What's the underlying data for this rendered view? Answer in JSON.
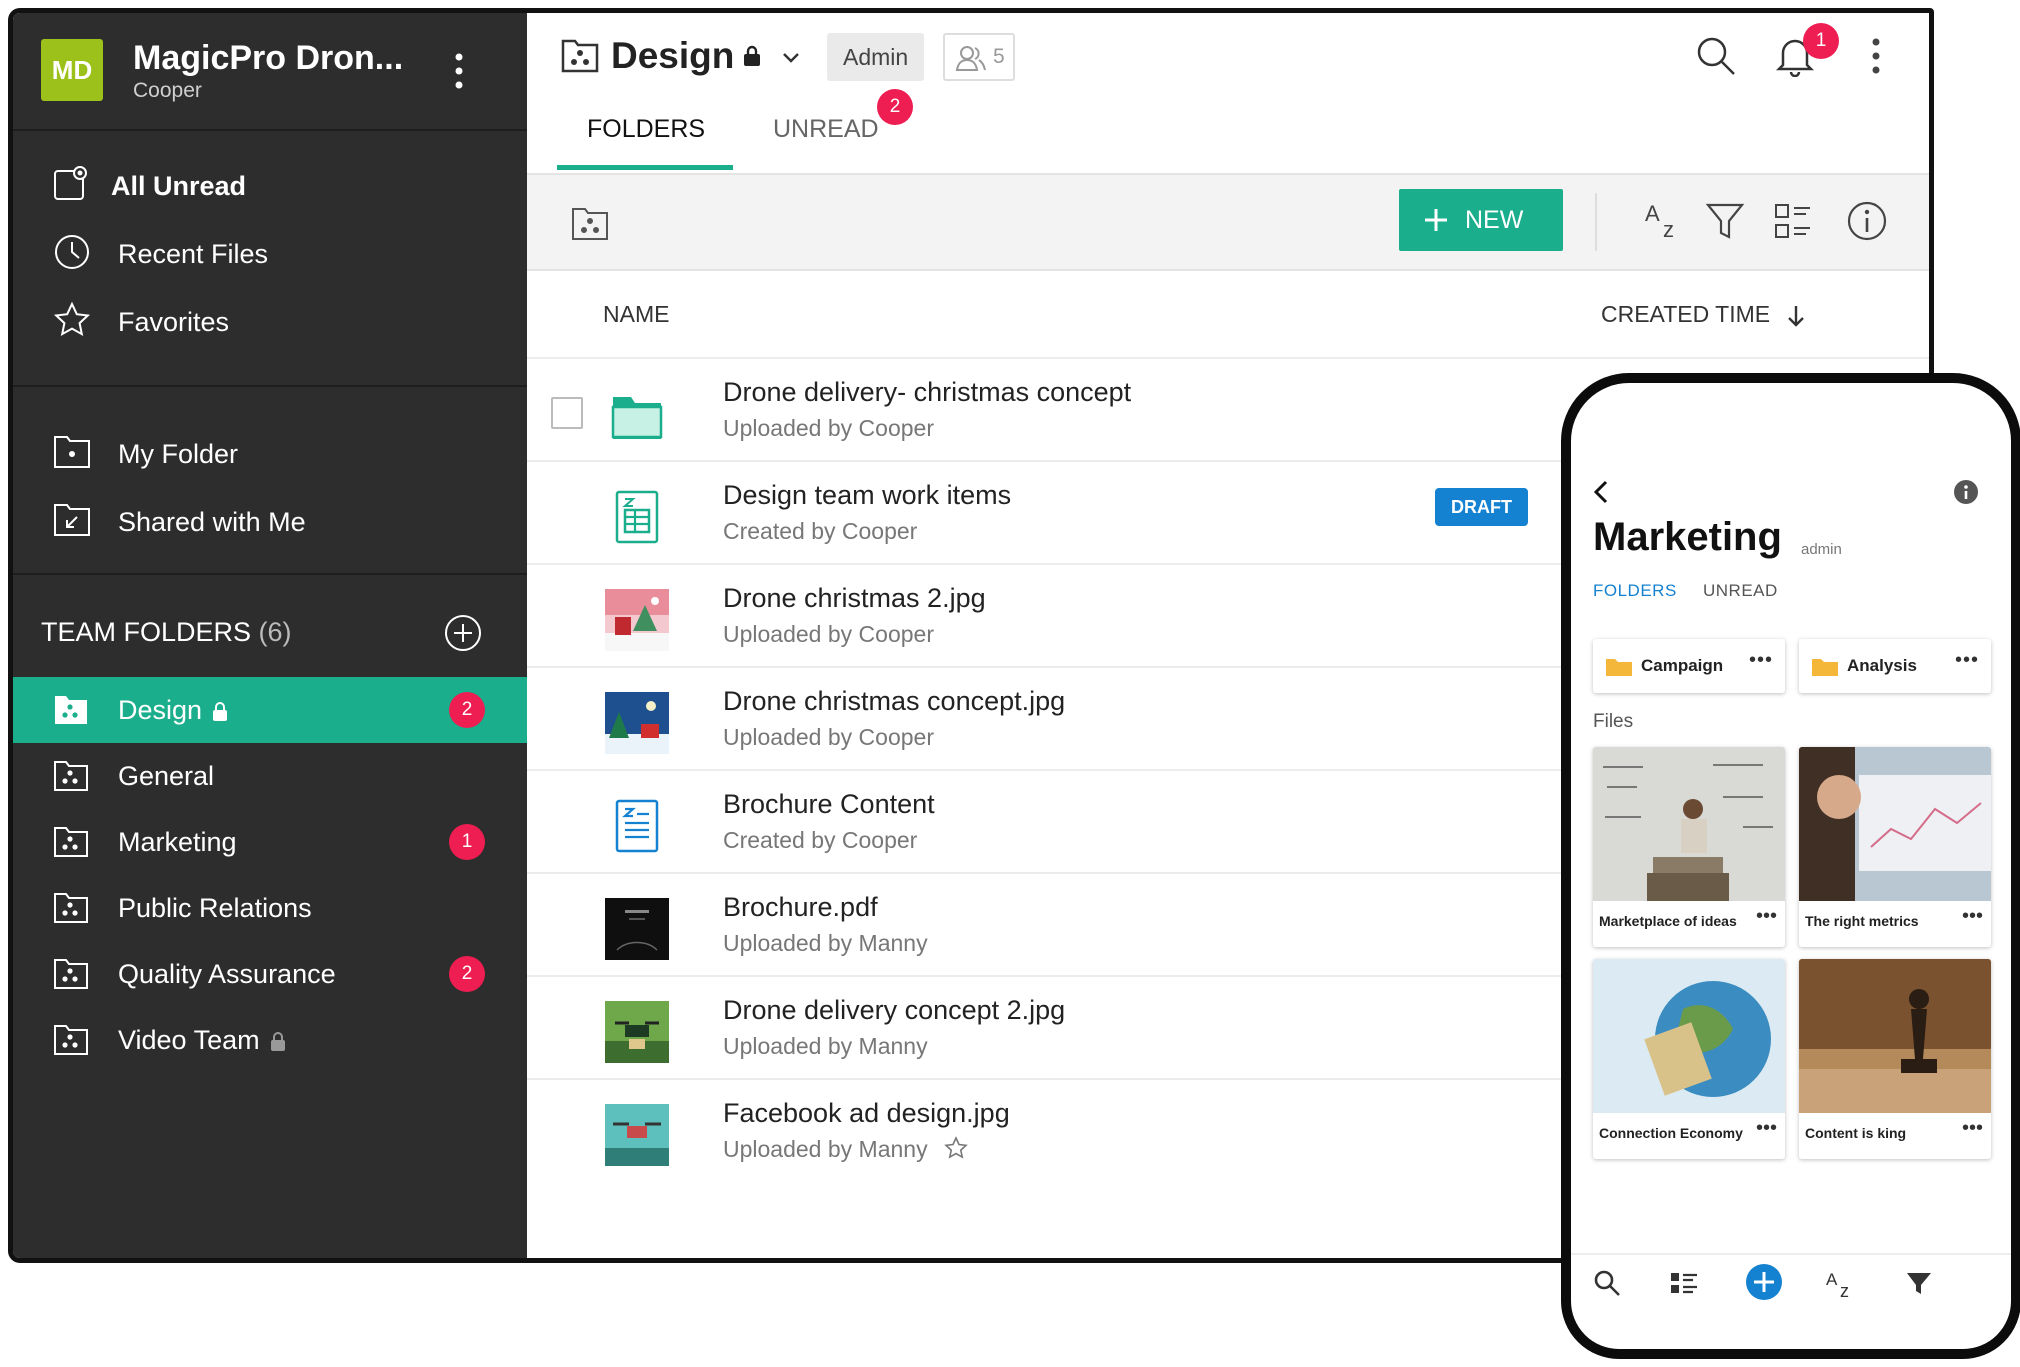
{
  "org": {
    "initials": "MD",
    "name": "MagicPro Dron...",
    "user": "Cooper",
    "logo_color": "#9dc11b"
  },
  "nav": [
    {
      "label": "All Unread",
      "icon": "all-unread-icon",
      "bold": true
    },
    {
      "label": "Recent Files",
      "icon": "clock-icon"
    },
    {
      "label": "Favorites",
      "icon": "star-icon"
    },
    {
      "label": "My Folder",
      "icon": "folder-icon"
    },
    {
      "label": "Shared with Me",
      "icon": "shared-folder-icon"
    }
  ],
  "team_folders": {
    "title": "TEAM FOLDERS",
    "count": "(6)",
    "items": [
      {
        "label": "Design",
        "locked": true,
        "badge": "2",
        "active": true
      },
      {
        "label": "General"
      },
      {
        "label": "Marketing",
        "badge": "1"
      },
      {
        "label": "Public Relations"
      },
      {
        "label": "Quality Assurance",
        "badge": "2"
      },
      {
        "label": "Video Team",
        "locked": true
      }
    ]
  },
  "header": {
    "title": "Design",
    "role": "Admin",
    "members": "5",
    "notifications": "1",
    "tabs": [
      {
        "label": "FOLDERS",
        "active": true
      },
      {
        "label": "UNREAD",
        "badge": "2"
      }
    ]
  },
  "toolbar": {
    "new_label": "NEW"
  },
  "columns": {
    "name": "NAME",
    "time": "CREATED TIME"
  },
  "files": [
    {
      "name": "Drone delivery- christmas concept",
      "meta": "Uploaded by  Cooper",
      "type": "folder"
    },
    {
      "name": "Design team work items",
      "meta": "Created by  Cooper",
      "type": "sheet",
      "badge": "DRAFT"
    },
    {
      "name": "Drone christmas 2.jpg",
      "meta": "Uploaded by  Cooper",
      "type": "image"
    },
    {
      "name": "Drone christmas concept.jpg",
      "meta": "Uploaded by  Cooper",
      "type": "image"
    },
    {
      "name": "Brochure Content",
      "meta": "Created by  Cooper",
      "type": "doc"
    },
    {
      "name": "Brochure.pdf",
      "meta": "Uploaded by  Manny",
      "type": "pdf"
    },
    {
      "name": "Drone delivery concept 2.jpg",
      "meta": "Uploaded by  Manny",
      "type": "image"
    },
    {
      "name": "Facebook ad design.jpg",
      "meta": "Uploaded by  Manny",
      "type": "image",
      "star": true
    }
  ],
  "phone": {
    "title": "Marketing",
    "role": "admin",
    "tabs": [
      "FOLDERS",
      "UNREAD"
    ],
    "folders": [
      "Campaign",
      "Analysis"
    ],
    "files_label": "Files",
    "files": [
      "Marketplace of ideas",
      "The right metrics",
      "Connection Economy",
      "Content is king"
    ]
  },
  "colors": {
    "accent": "#1aae8c",
    "sidebar": "#2d2d2d",
    "badge": "#ee1d52",
    "draft": "#1482d0",
    "phone_accent": "#1482d0"
  }
}
